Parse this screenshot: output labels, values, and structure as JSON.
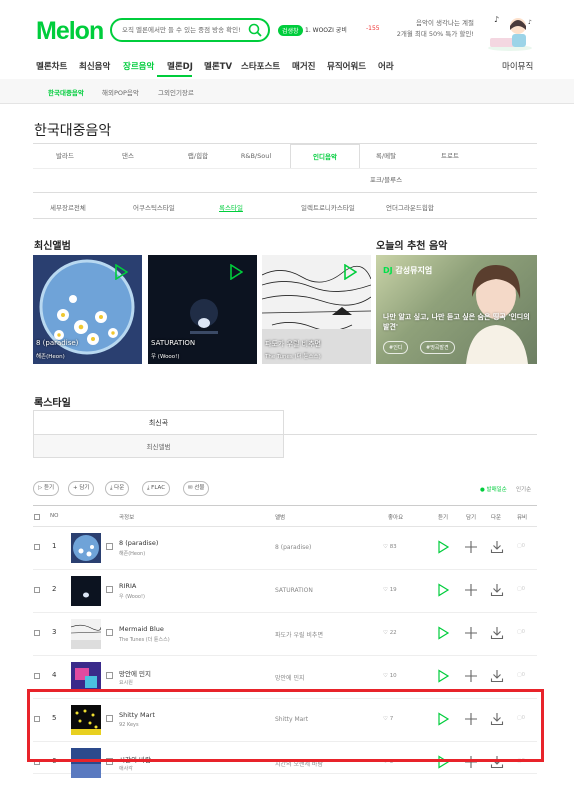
{
  "header": {
    "logo": "Melon",
    "search_placeholder": "오직 멜론에서만 들 수 있는 중점 방송 확인!",
    "gem_badge": "검생창",
    "hot_text_1": "1. WOOZI 궁비",
    "hot_text_2": "-155",
    "promo_line_1": "음악이 생각나는 계절",
    "promo_line_2": "2개월 최대 50% 특가 할인!"
  },
  "gnb": [
    {
      "label": "멜론차트",
      "active": false
    },
    {
      "label": "최신음악",
      "active": false
    },
    {
      "label": "장르음악",
      "active": true
    },
    {
      "label": "멜론DJ",
      "active": false
    },
    {
      "label": "멜론TV",
      "active": false
    },
    {
      "label": "스타포스트",
      "active": false
    },
    {
      "label": "매거진",
      "active": false
    },
    {
      "label": "뮤직어워드",
      "active": false
    },
    {
      "label": "어라",
      "active": false
    }
  ],
  "gnb_right": "마이뮤직",
  "subnav": [
    {
      "label": "한국대중음악",
      "active": true
    },
    {
      "label": "해외POP음악",
      "active": false
    },
    {
      "label": "그외인기장르",
      "active": false
    }
  ],
  "page_title": "한국대중음악",
  "genre_tabs": [
    {
      "label": "발라드",
      "active": false
    },
    {
      "label": "댄스",
      "active": false
    },
    {
      "label": "랩/힙합",
      "active": false
    },
    {
      "label": "R&B/Soul",
      "active": false
    },
    {
      "label": "인디음악",
      "active": true
    },
    {
      "label": "록/메탈",
      "active": false
    },
    {
      "label": "트로트",
      "active": false
    }
  ],
  "genre_tab_row2": "포크/블루스",
  "sub_tabs": [
    {
      "label": "세부장르전체",
      "active": false
    },
    {
      "label": "어쿠스틱스타일",
      "active": false
    },
    {
      "label": "록스타일",
      "active": true
    },
    {
      "label": "일렉트로니카스타일",
      "active": false
    },
    {
      "label": "언더그라운드힙합",
      "active": false
    }
  ],
  "latest_albums_title": "최신앨범",
  "recommend_title": "오늘의 추천 음악",
  "albums": [
    {
      "title": "8 (paradise)",
      "artist": "해존(Heon)"
    },
    {
      "title": "SATURATION",
      "artist": "우 (Wooo!)"
    },
    {
      "title": "파도가 우릴 비추면",
      "artist": "The Tunes (더 튠스스)"
    }
  ],
  "recommend": {
    "dj_label": "DJ",
    "dj_title": "감성뮤지엄",
    "text": "나만 알고 싶고, 나만 듣고 싶은 숨은 띵곡 '인디의 발견'",
    "tags": [
      "#인디",
      "#띵곡발견"
    ]
  },
  "style_section_title": "록스타일",
  "style_tabs": {
    "tab1": "최신곡",
    "tab2": "최신앨범"
  },
  "action_buttons": [
    "▷ 듣기",
    "+ 담기",
    "⤓ 다운",
    "⤓ FLAC",
    "✉ 선물"
  ],
  "sort": {
    "a": "● 발매일순",
    "b": "인기순"
  },
  "table_headers": {
    "no": "NO",
    "song": "곡정보",
    "album": "앨범",
    "like": "좋아요",
    "listen": "듣기",
    "add": "담기",
    "download": "다운",
    "mv": "뮤비"
  },
  "rows": [
    {
      "no": "1",
      "title": "8 (paradise)",
      "artist": "해존(Heon)",
      "album": "8 (paradise)",
      "likes": "83"
    },
    {
      "no": "2",
      "title": "RIRIA",
      "artist": "우 (Wooo!)",
      "album": "SATURATION",
      "likes": "19"
    },
    {
      "no": "3",
      "title": "Mermaid Blue",
      "artist": "The Tunes (더 튠스스)",
      "album": "파도가 우릴 비추면",
      "likes": "22"
    },
    {
      "no": "4",
      "title": "망안에 민지",
      "artist": "요시원",
      "album": "망안에 민지",
      "likes": "10"
    },
    {
      "no": "5",
      "title": "Shitty Mart",
      "artist": "92 Keys",
      "album": "Shitty Mart",
      "likes": "7"
    },
    {
      "no": "6",
      "title": "시간의 바람",
      "artist": "애사각",
      "album": "시간의 오랜세 바람",
      "likes": "5"
    }
  ],
  "row_mv_value": "0",
  "colors": {
    "brand": "#00cd3c",
    "highlight": "#e8232a"
  }
}
